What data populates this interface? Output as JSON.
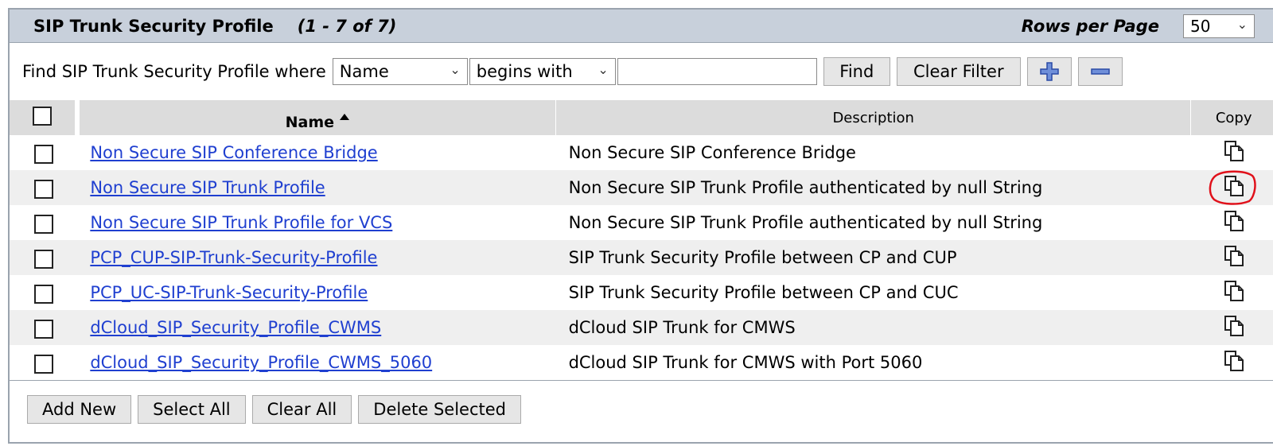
{
  "header": {
    "title": "SIP Trunk Security Profile",
    "count": "(1 - 7 of 7)",
    "rows_per_page_label": "Rows per Page",
    "rows_per_page_value": "50"
  },
  "filter": {
    "label": "Find SIP Trunk Security Profile where",
    "field_value": "Name",
    "operator_value": "begins with",
    "search_value": "",
    "find_label": "Find",
    "clear_filter_label": "Clear Filter"
  },
  "table": {
    "headers": {
      "name": "Name",
      "description": "Description",
      "copy": "Copy"
    },
    "rows": [
      {
        "name": "Non Secure SIP Conference Bridge",
        "description": "Non Secure SIP Conference Bridge"
      },
      {
        "name": "Non Secure SIP Trunk Profile",
        "description": "Non Secure SIP Trunk Profile authenticated by null String"
      },
      {
        "name": "Non Secure SIP Trunk Profile for VCS",
        "description": "Non Secure SIP Trunk Profile authenticated by null String"
      },
      {
        "name": "PCP_CUP-SIP-Trunk-Security-Profile",
        "description": "SIP Trunk Security Profile between CP and CUP"
      },
      {
        "name": "PCP_UC-SIP-Trunk-Security-Profile",
        "description": "SIP Trunk Security Profile between CP and CUC"
      },
      {
        "name": "dCloud_SIP_Security_Profile_CWMS",
        "description": "dCloud SIP Trunk for CMWS"
      },
      {
        "name": "dCloud_SIP_Security_Profile_CWMS_5060",
        "description": "dCloud SIP Trunk for CMWS with Port 5060"
      }
    ]
  },
  "footer": {
    "add_new": "Add New",
    "select_all": "Select All",
    "clear_all": "Clear All",
    "delete_selected": "Delete Selected"
  },
  "icons": {
    "add": "plus-icon",
    "remove": "minus-icon",
    "copy": "copy-icon",
    "sort": "sort-ascending-icon",
    "highlight_color": "#e0101a"
  }
}
